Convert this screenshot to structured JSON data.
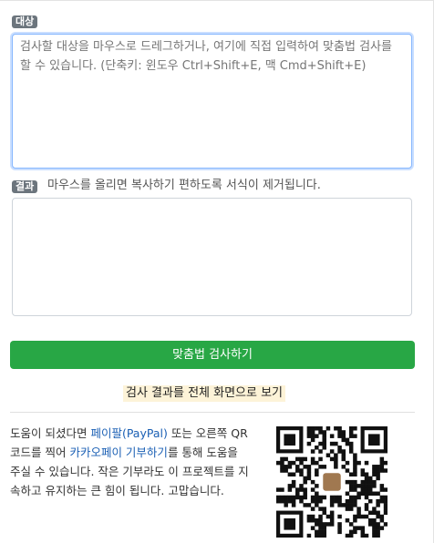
{
  "target_label": "대상",
  "target_placeholder": "검사할 대상을 마우스로 드레그하거나, 여기에 직접 입력하여 맞춤법 검사를 할 수 있습니다. (단축키: 윈도우 Ctrl+Shift+E, 맥 Cmd+Shift+E)",
  "result_label": "결과",
  "result_hint": "마우스를 올리면 복사하기 편하도록 서식이 제거됩니다.",
  "check_button": "맞춤법 검사하기",
  "fullscreen_link": "검사 결과를 전체 화면으로 보기",
  "support": {
    "part1": "도움이 되셨다면 ",
    "paypal_link": "페이팔(PayPal)",
    "part2": " 또는 오른쪽 QR코드를 찍어 ",
    "kakaopay_link": "카카오페이 기부하기",
    "part3": "를 통해 도움을 주실 수 있습니다. 작은 기부라도 이 프로젝트를 지속하고 유지하는 큰 힘이 됩니다. 고맙습니다."
  },
  "qr_icon": "kakaopay-qr-code-icon",
  "colors": {
    "primary_button": "#28a745",
    "badge": "#6c757d",
    "link": "#1a5fb4",
    "highlight": "#fdf3d8",
    "focus_border": "#86b7fe"
  }
}
